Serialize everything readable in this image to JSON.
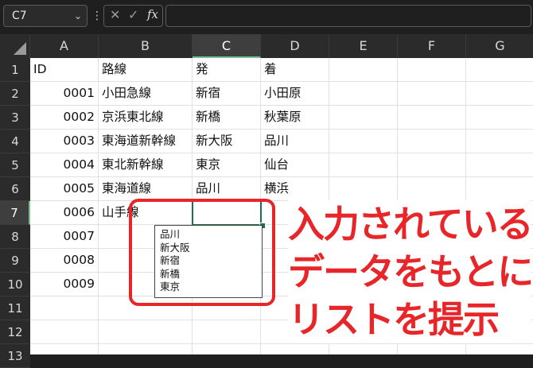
{
  "formula_bar": {
    "name_box": "C7",
    "name_box_chevron": "chevron-down-icon",
    "more_dots": "⋮",
    "cancel_glyph": "✕",
    "enter_glyph": "✓",
    "fx_glyph": "fx",
    "formula_value": ""
  },
  "sheet": {
    "columns": [
      "A",
      "B",
      "C",
      "D",
      "E",
      "F",
      "G"
    ],
    "selected_column": "C",
    "rows": [
      "1",
      "2",
      "3",
      "4",
      "5",
      "6",
      "7",
      "8",
      "9",
      "10",
      "11",
      "12",
      "13"
    ],
    "selected_row": "7",
    "cells": {
      "r1": {
        "A": "ID",
        "B": "路線",
        "C": "発",
        "D": "着"
      },
      "r2": {
        "A": "0001",
        "B": "小田急線",
        "C": "新宿",
        "D": "小田原"
      },
      "r3": {
        "A": "0002",
        "B": "京浜東北線",
        "C": "新橋",
        "D": "秋葉原"
      },
      "r4": {
        "A": "0003",
        "B": "東海道新幹線",
        "C": "新大阪",
        "D": "品川"
      },
      "r5": {
        "A": "0004",
        "B": "東北新幹線",
        "C": "東京",
        "D": "仙台"
      },
      "r6": {
        "A": "0005",
        "B": "東海道線",
        "C": "品川",
        "D": "横浜"
      },
      "r7": {
        "A": "0006",
        "B": "山手線",
        "C": "",
        "D": ""
      },
      "r8": {
        "A": "0007"
      },
      "r9": {
        "A": "0008"
      },
      "r10": {
        "A": "0009"
      }
    }
  },
  "autocomplete": {
    "items": [
      "品川",
      "新大阪",
      "新宿",
      "新橋",
      "東京"
    ]
  },
  "annotation": {
    "lines": [
      "入力されている",
      "データをもとに",
      "リストを提示"
    ],
    "color": "#e8262a"
  }
}
